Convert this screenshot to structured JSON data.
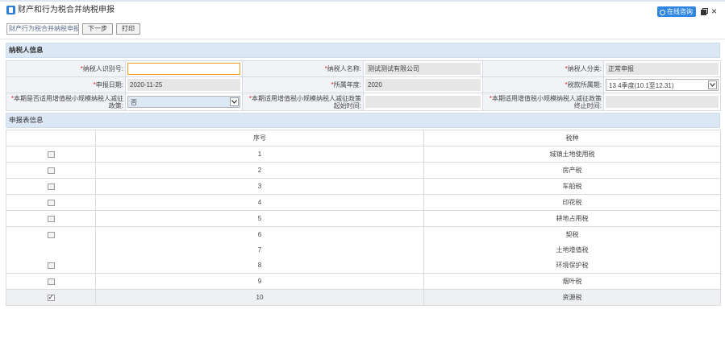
{
  "window": {
    "title": "财产和行为税合并纳税申报",
    "consult_label": "在线咨询",
    "accent_color": "#2f86e0"
  },
  "toolbar": {
    "selector_value": "财产行为税合并纳税申报",
    "next_label": "下一步",
    "print_label": "打印"
  },
  "taxpayer_section": {
    "title": "纳税人信息",
    "required_mark": "*",
    "taxpayer_id_label": "纳税人识别号:",
    "taxpayer_id_value": "",
    "taxpayer_name_label": "纳税人名称:",
    "taxpayer_name_value": "测试测试有限公司",
    "taxpayer_type_label": "纳税人分类:",
    "taxpayer_type_value": "正常申报",
    "filing_date_label": "申报日期:",
    "filing_date_value": "2020-11-25",
    "year_label": "所属年度:",
    "year_value": "2020",
    "period_label": "税款所属期:",
    "period_value": "13 4季度(10.1至12.31)",
    "small_scale_label": "本期是否适用增值税小规模纳税人减征政策:",
    "small_scale_value": "否",
    "start_time_label": "本期适用增值税小规模纳税人减征政策起始时间:",
    "start_time_value": "",
    "end_time_label": "本期适用增值税小规模纳税人减征政策终止时间:",
    "end_time_value": ""
  },
  "forms_section": {
    "title": "申报表信息",
    "columns": [
      "",
      "序号",
      "税种"
    ],
    "rows": [
      {
        "no": "1",
        "tax": "城镇土地使用税",
        "checked": false
      },
      {
        "no": "2",
        "tax": "房产税",
        "checked": false
      },
      {
        "no": "3",
        "tax": "车船税",
        "checked": false
      },
      {
        "no": "4",
        "tax": "印花税",
        "checked": false
      },
      {
        "no": "5",
        "tax": "耕地占用税",
        "checked": false
      },
      {
        "no": "6",
        "tax": "契税",
        "checked": false
      },
      {
        "no": "7",
        "tax": "土地增值税"
      },
      {
        "no": "8",
        "tax": "环境保护税",
        "checked": false
      },
      {
        "no": "9",
        "tax": "烟叶税",
        "checked": false
      },
      {
        "no": "10",
        "tax": "资源税",
        "checked": true
      }
    ]
  }
}
